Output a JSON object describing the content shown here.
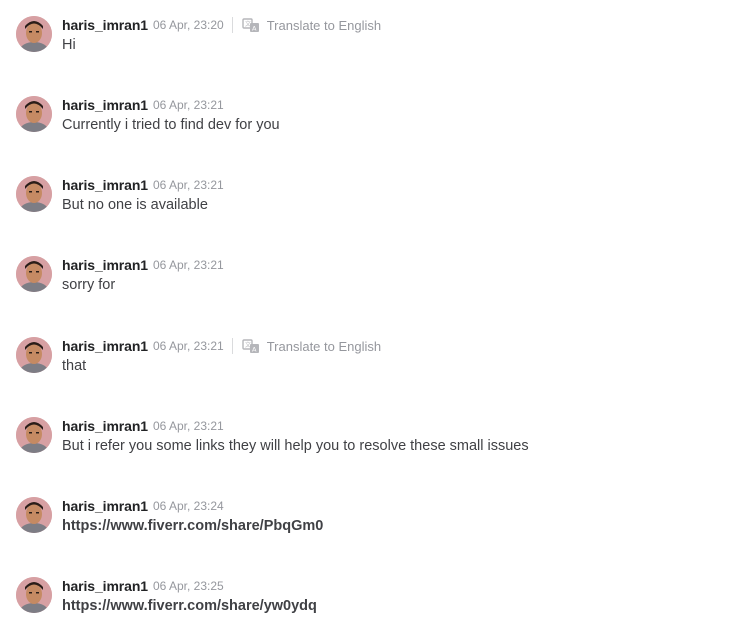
{
  "translate_label": "Translate to English",
  "messages": [
    {
      "user": "haris_imran1",
      "time": "06 Apr, 23:20",
      "text": "Hi"
    },
    {
      "user": "haris_imran1",
      "time": "06 Apr, 23:21",
      "text": "Currently i tried to find dev for you"
    },
    {
      "user": "haris_imran1",
      "time": "06 Apr, 23:21",
      "text": "But no one is available"
    },
    {
      "user": "haris_imran1",
      "time": "06 Apr, 23:21",
      "text": "sorry for"
    },
    {
      "user": "haris_imran1",
      "time": "06 Apr, 23:21",
      "text": "that"
    },
    {
      "user": "haris_imran1",
      "time": "06 Apr, 23:21",
      "text": "But i refer you some links they will help you to resolve these small issues"
    },
    {
      "user": "haris_imran1",
      "time": "06 Apr, 23:24",
      "text": "https://www.fiverr.com/share/PbqGm0"
    },
    {
      "user": "haris_imran1",
      "time": "06 Apr, 23:25",
      "text": "https://www.fiverr.com/share/yw0ydq"
    }
  ]
}
